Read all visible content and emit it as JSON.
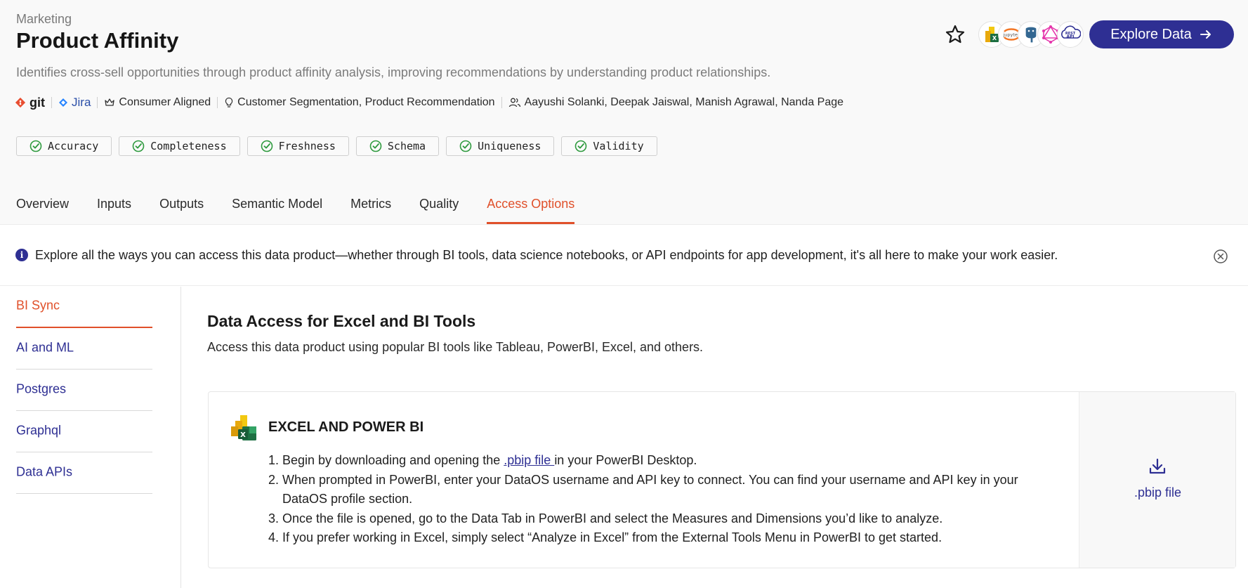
{
  "header": {
    "breadcrumb": "Marketing",
    "title": "Product Affinity",
    "description": "Identifies cross-sell opportunities through product affinity analysis, improving recommendations by understanding product relationships.",
    "git_label": "git",
    "jira_label": "Jira",
    "alignment": "Consumer Aligned",
    "use_cases": "Customer Segmentation, Product Recommendation",
    "owners": "Aayushi Solanki, Deepak Jaiswal, Manish Agrawal, Nanda Page",
    "explore_label": "Explore Data",
    "tools": [
      "excel-powerbi",
      "jupyter",
      "postgres",
      "graphql",
      "rest-api"
    ],
    "tool_labels": {
      "jupyter": "jupyter",
      "rest": "REST",
      "api": "API"
    }
  },
  "quality_badges": [
    "Accuracy",
    "Completeness",
    "Freshness",
    "Schema",
    "Uniqueness",
    "Validity"
  ],
  "tabs": [
    "Overview",
    "Inputs",
    "Outputs",
    "Semantic Model",
    "Metrics",
    "Quality",
    "Access Options"
  ],
  "active_tab": "Access Options",
  "info_banner": {
    "icon": "i",
    "text": "Explore all the ways you can access this data product—whether through BI tools, data science notebooks, or API endpoints for app development, it's all here to make your work easier."
  },
  "sidebar": {
    "items": [
      "BI Sync",
      "AI and ML",
      "Postgres",
      "Graphql",
      "Data APIs"
    ],
    "active": "BI Sync"
  },
  "main": {
    "title": "Data Access for Excel and BI Tools",
    "subtitle": "Access this data product using popular BI tools like Tableau, PowerBI, Excel, and others.",
    "card": {
      "logo_letter": "X",
      "title": "EXCEL AND POWER BI",
      "step_numbers": [
        "1.",
        "2.",
        "3.",
        "4."
      ],
      "step1_before": "Begin by downloading and opening the ",
      "step1_link": ".pbip file ",
      "step1_after": "in your PowerBI Desktop.",
      "step2": "When prompted in PowerBI, enter your DataOS username and API key to connect. You can find your username and API key in your DataOS profile section.",
      "step3": "Once the file is opened, go to the Data Tab in PowerBI and select the Measures and Dimensions you’d like to analyze.",
      "step4": "If you prefer working in Excel, simply select “Analyze in Excel” from the External Tools Menu in PowerBI to get started.",
      "download_label": ".pbip file"
    }
  },
  "colors": {
    "accent": "#e0502a",
    "primary": "#2e2f93",
    "check": "#2e9a3e",
    "header_bg": "#f9f9f9"
  }
}
